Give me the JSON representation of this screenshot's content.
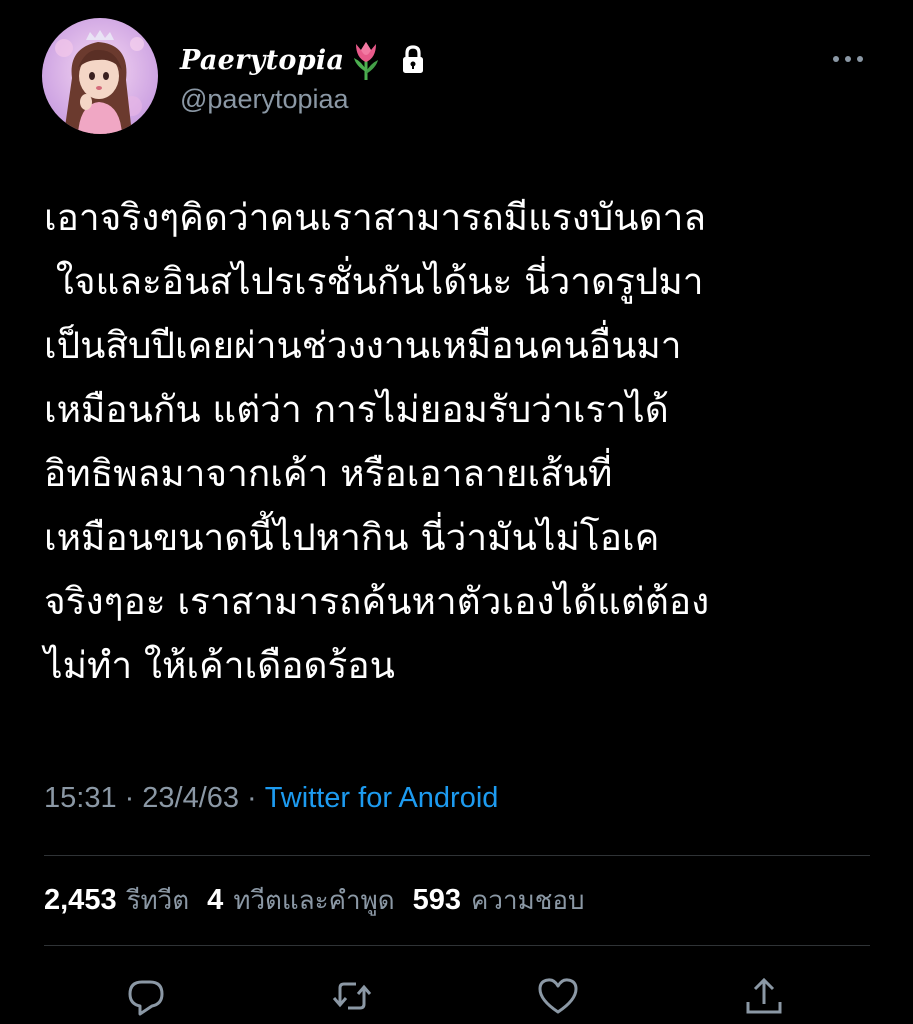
{
  "header": {
    "display_name": "Paerytopia",
    "handle": "@paerytopiaa",
    "name_emoji": "tulip-icon",
    "protected_icon": "lock-icon",
    "more_icon": "more-horizontal-icon"
  },
  "tweet": {
    "text": "เอาจริงๆคิดว่าคนเราสามารถมีแรงบันดาล\n ใจและอินสไปรเรชั่นกันได้นะ นี่วาดรูปมา\nเป็นสิบปีเคยผ่านช่วงงานเหมือนคนอื่นมา\nเหมือนกัน แต่ว่า การไม่ยอมรับว่าเราได้\nอิทธิพลมาจากเค้า หรือเอาลายเส้นที่\nเหมือนขนาดนี้ไปหากิน นี่ว่ามันไม่โอเค\nจริงๆอะ เราสามารถค้นหาตัวเองได้แต่ต้อง\nไม่ทำ ให้เค้าเดือดร้อน",
    "time": "15:31",
    "date": "23/4/63",
    "separator": "·",
    "source": "Twitter for Android"
  },
  "stats": {
    "retweets_count": "2,453",
    "retweets_label": "รีทวีต",
    "quotes_count": "4",
    "quotes_label": "ทวีตและคำพูด",
    "likes_count": "593",
    "likes_label": "ความชอบ"
  },
  "actions": {
    "reply_icon": "reply-icon",
    "retweet_icon": "retweet-icon",
    "like_icon": "heart-icon",
    "share_icon": "share-icon"
  },
  "colors": {
    "background": "#000000",
    "text": "#ffffff",
    "secondary": "#8b98a5",
    "link": "#1d9bf0",
    "divider": "#2f3336"
  }
}
